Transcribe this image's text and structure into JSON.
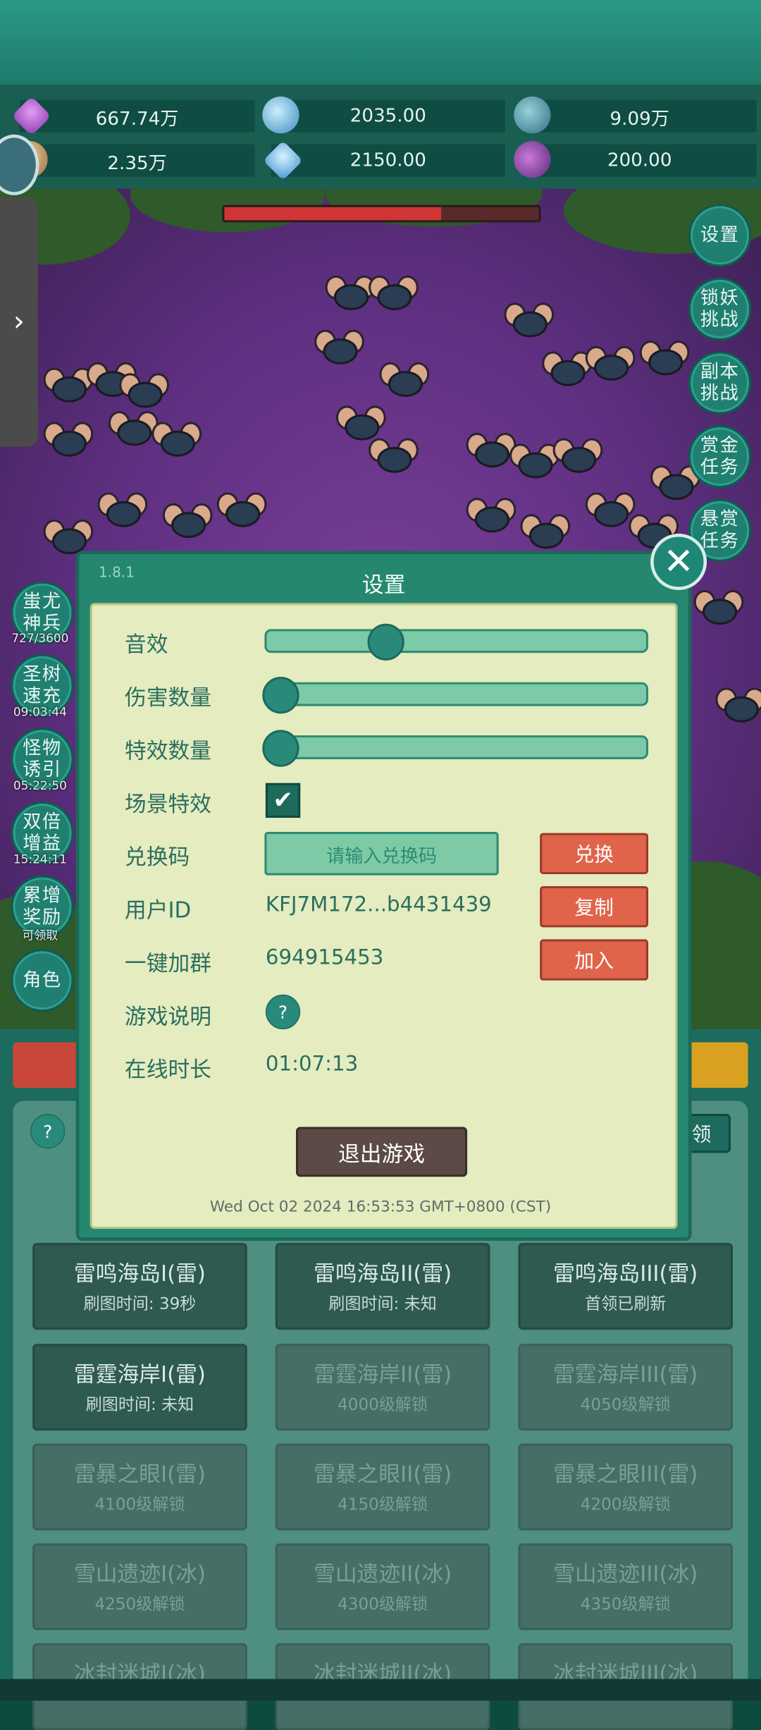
{
  "resources": [
    {
      "icon": "purple-gem-icon",
      "value": "667.74万"
    },
    {
      "icon": "blue-orb-icon",
      "value": "2035.00"
    },
    {
      "icon": "planet-orb-icon",
      "value": "9.09万"
    },
    {
      "icon": "horn-icon",
      "value": "2.35万"
    },
    {
      "icon": "ice-crystal-icon",
      "value": "2150.00"
    },
    {
      "icon": "potion-icon",
      "value": "200.00"
    }
  ],
  "right_menu": [
    {
      "label": "设置"
    },
    {
      "label": "锁妖挑战"
    },
    {
      "label": "副本挑战"
    },
    {
      "label": "赏金任务"
    },
    {
      "label": "悬赏任务"
    }
  ],
  "left_menu": [
    {
      "label": "蚩尤神兵",
      "timer": "727/3600"
    },
    {
      "label": "圣树速充",
      "timer": "09:03:44"
    },
    {
      "label": "怪物诱引",
      "timer": "05:22:50"
    },
    {
      "label": "双倍增益",
      "timer": "15:24:11"
    },
    {
      "label": "累增奖励",
      "timer": "可领取"
    },
    {
      "label": "角色",
      "timer": ""
    }
  ],
  "settings": {
    "version": "1.8.1",
    "title": "设置",
    "sound_label": "音效",
    "sound_level": 0.3,
    "damage_label": "伤害数量",
    "damage_level": 0.0,
    "effects_label": "特效数量",
    "effects_level": 0.0,
    "scene_effects_label": "场景特效",
    "scene_effects_checked": true,
    "redeem_label": "兑换码",
    "redeem_placeholder": "请输入兑换码",
    "redeem_button": "兑换",
    "user_id_label": "用户ID",
    "user_id_value": "KFJ7M172...b4431439",
    "copy_button": "复制",
    "group_label": "一键加群",
    "group_value": "694915453",
    "join_button": "加入",
    "help_label": "游戏说明",
    "help_icon_text": "?",
    "online_label": "在线时长",
    "online_value": "01:07:13",
    "exit_button": "退出游戏",
    "datetime": "Wed Oct 02 2024 16:53:53 GMT+0800 (CST)"
  },
  "panel": {
    "help": "?",
    "claim_button": "领"
  },
  "dungeon_tiles": [
    {
      "name": "雷鸣海岛I(雷)",
      "sub": "刷图时间: 39秒",
      "locked": false
    },
    {
      "name": "雷鸣海岛II(雷)",
      "sub": "刷图时间: 未知",
      "locked": false
    },
    {
      "name": "雷鸣海岛III(雷)",
      "sub": "首领已刷新",
      "locked": false
    },
    {
      "name": "雷霆海岸I(雷)",
      "sub": "刷图时间: 未知",
      "locked": false
    },
    {
      "name": "雷霆海岸II(雷)",
      "sub": "4000级解锁",
      "locked": true
    },
    {
      "name": "雷霆海岸III(雷)",
      "sub": "4050级解锁",
      "locked": true
    },
    {
      "name": "雷暴之眼I(雷)",
      "sub": "4100级解锁",
      "locked": true
    },
    {
      "name": "雷暴之眼II(雷)",
      "sub": "4150级解锁",
      "locked": true
    },
    {
      "name": "雷暴之眼III(雷)",
      "sub": "4200级解锁",
      "locked": true
    },
    {
      "name": "雪山遗迹I(冰)",
      "sub": "4250级解锁",
      "locked": true
    },
    {
      "name": "雪山遗迹II(冰)",
      "sub": "4300级解锁",
      "locked": true
    },
    {
      "name": "雪山遗迹III(冰)",
      "sub": "4350级解锁",
      "locked": true
    },
    {
      "name": "冰封迷城I(冰)",
      "sub": "",
      "locked": true
    },
    {
      "name": "冰封迷城II(冰)",
      "sub": "",
      "locked": true
    },
    {
      "name": "冰封迷城III(冰)",
      "sub": "",
      "locked": true
    }
  ]
}
